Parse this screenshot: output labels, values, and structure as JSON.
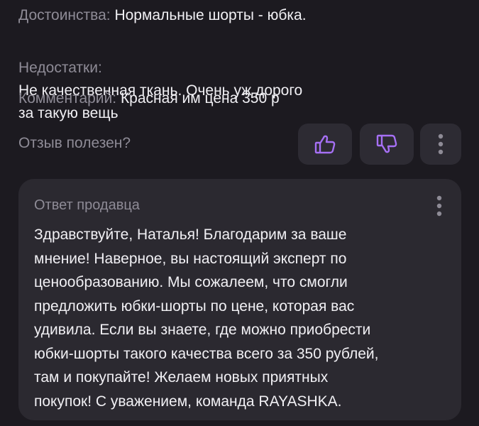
{
  "review": {
    "advantages": {
      "label": "Достоинства:",
      "value": "Нормальные шорты - юбка."
    },
    "disadvantages": {
      "label": "Недостатки:",
      "value": "Не качественная ткань. Очень уж дорого\nза такую вещь"
    },
    "comment": {
      "label": "Комментарий:",
      "value": "Красная им цена 350 р"
    }
  },
  "helpful": {
    "question": "Отзыв полезен?",
    "like_icon": "thumbs-up-icon",
    "dislike_icon": "thumbs-down-icon",
    "more_icon": "more-vertical-icon"
  },
  "seller_reply": {
    "title": "Ответ продавца",
    "text": "Здравствуйте, Наталья! Благодарим за ваше\nмнение! Наверное, вы настоящий эксперт по\nценообразованию. Мы сожалеем, что смогли\nпредложить юбки-шорты по цене, которая вас\nудивила. Если вы знаете, где можно приобрести\nюбки-шорты такого качества всего за 350 рублей,\nтам и покупайте! Желаем новых приятных\nпокупок! С уважением, команда RAYASHKA.",
    "more_icon": "more-vertical-icon"
  },
  "colors": {
    "background": "#1c1a20",
    "card": "#2b2930",
    "button": "#2d2b33",
    "label": "#8e8b96",
    "text": "#f1f0f4",
    "accent": "#a670f5"
  }
}
